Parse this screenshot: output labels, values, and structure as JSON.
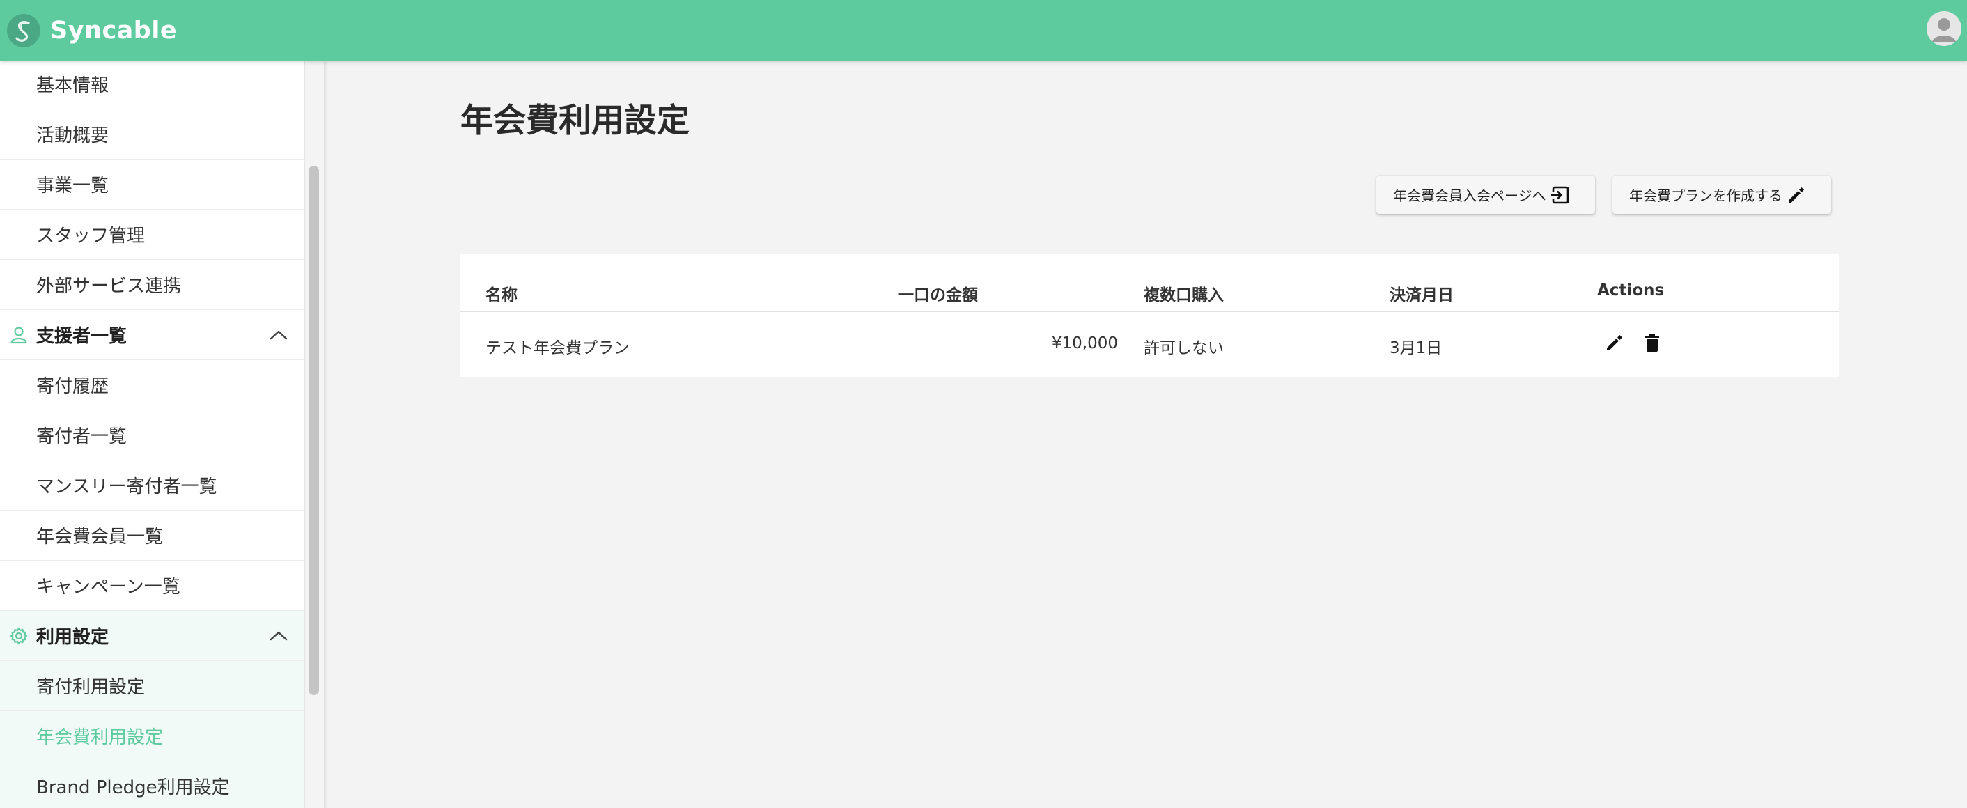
{
  "app": {
    "logo_text": "Syncable",
    "colors": {
      "brand": "#5ecb9f",
      "brand_dark": "#4aa885",
      "active_bg": "#f1faf6"
    }
  },
  "sidebar": {
    "items": [
      {
        "label": "基本情報"
      },
      {
        "label": "活動概要"
      },
      {
        "label": "事業一覧"
      },
      {
        "label": "スタッフ管理"
      },
      {
        "label": "外部サービス連携"
      },
      {
        "label": "支援者一覧",
        "section": true,
        "icon": "person-icon"
      },
      {
        "label": "寄付履歴"
      },
      {
        "label": "寄付者一覧"
      },
      {
        "label": "マンスリー寄付者一覧"
      },
      {
        "label": "年会費会員一覧"
      },
      {
        "label": "キャンペーン一覧"
      },
      {
        "label": "利用設定",
        "section": true,
        "icon": "gear-icon"
      },
      {
        "label": "寄付利用設定"
      },
      {
        "label": "年会費利用設定",
        "active": true
      },
      {
        "label": "Brand Pledge利用設定"
      }
    ]
  },
  "main": {
    "title": "年会費利用設定",
    "buttons": {
      "join_page": "年会費会員入会ページへ",
      "create_plan": "年会費プランを作成する"
    },
    "table": {
      "headers": [
        "名称",
        "一口の金額",
        "複数口購入",
        "決済月日",
        "Actions"
      ],
      "rows": [
        {
          "name": "テスト年会費プラン",
          "amount": "¥10,000",
          "multiple": "許可しない",
          "billing_date": "3月1日"
        }
      ]
    }
  }
}
